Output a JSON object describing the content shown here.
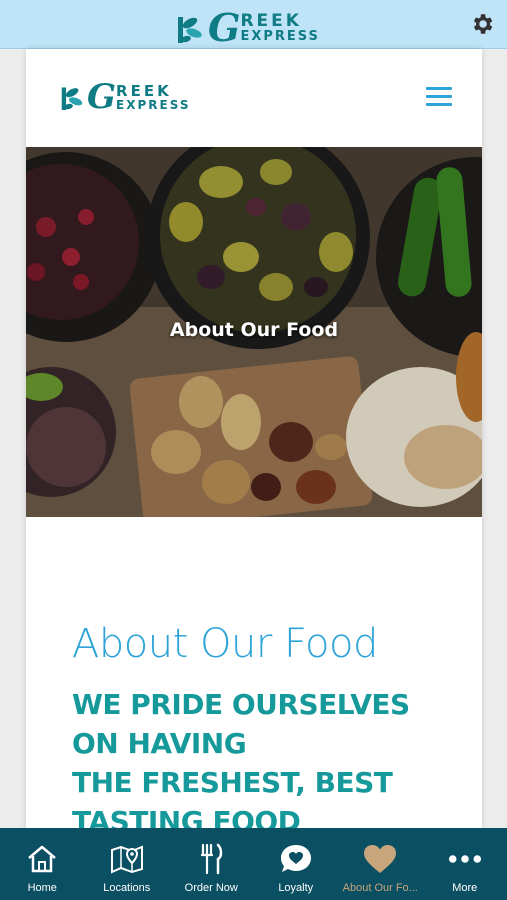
{
  "app": {
    "logo_top_word": "REEK",
    "logo_bottom_word": "EXPRESS",
    "logo_letter": "G"
  },
  "site": {
    "logo_top_word": "REEK",
    "logo_bottom_word": "EXPRESS",
    "logo_letter": "G"
  },
  "hero": {
    "title": "About Our Food"
  },
  "content": {
    "heading": "About Our Food",
    "tagline_lines": [
      "WE PRIDE OURSELVES",
      "ON HAVING",
      "THE FRESHEST, BEST",
      "TASTING FOOD"
    ]
  },
  "tabbar": {
    "items": [
      {
        "label": "Home",
        "icon": "home-icon"
      },
      {
        "label": "Locations",
        "icon": "map-icon"
      },
      {
        "label": "Order Now",
        "icon": "fork-knife-icon"
      },
      {
        "label": "Loyalty",
        "icon": "chat-heart-icon"
      },
      {
        "label": "About Our Fo...",
        "icon": "heart-icon"
      },
      {
        "label": "More",
        "icon": "more-icon"
      }
    ],
    "active_index": 4
  },
  "colors": {
    "topbar": "#bfe3f7",
    "brand_teal": "#0f7b84",
    "heading_blue": "#2ea3d8",
    "tagline_teal": "#16999a",
    "tabbar": "#0b4f63",
    "tab_active": "#c9a57c"
  }
}
